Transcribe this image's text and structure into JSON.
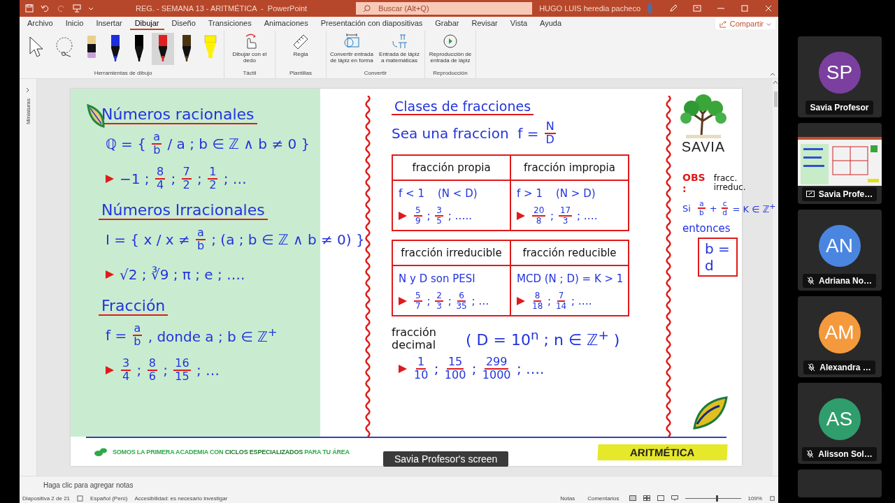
{
  "window": {
    "title": "REG. - SEMANA 13 - ARITMÉTICA  -  PowerPoint",
    "search": {
      "placeholder": "Buscar (Alt+Q)"
    },
    "user": "HUGO LUIS heredia pacheco"
  },
  "tabs": [
    {
      "label": "Archivo",
      "selected": false
    },
    {
      "label": "Inicio",
      "selected": false
    },
    {
      "label": "Insertar",
      "selected": false
    },
    {
      "label": "Dibujar",
      "selected": true
    },
    {
      "label": "Diseño",
      "selected": false
    },
    {
      "label": "Transiciones",
      "selected": false
    },
    {
      "label": "Animaciones",
      "selected": false
    },
    {
      "label": "Presentación con diapositivas",
      "selected": false
    },
    {
      "label": "Grabar",
      "selected": false
    },
    {
      "label": "Revisar",
      "selected": false
    },
    {
      "label": "Vista",
      "selected": false
    },
    {
      "label": "Ayuda",
      "selected": false
    }
  ],
  "share": "Compartir",
  "ribbon": {
    "drawing_tools": {
      "label": "Herramientas de dibujo",
      "pens": [
        {
          "kind": "eraser",
          "color": "#e8d08a",
          "selected": false
        },
        {
          "kind": "pen",
          "color": "#1c2fe0",
          "selected": false
        },
        {
          "kind": "pen",
          "color": "#000000",
          "selected": false
        },
        {
          "kind": "pen",
          "color": "#e02020",
          "selected": true
        },
        {
          "kind": "pen",
          "color": "#4a3410",
          "selected": false
        },
        {
          "kind": "highlighter",
          "color": "#fff200",
          "selected": false
        }
      ]
    },
    "groups": [
      {
        "label": "Táctil",
        "buttons": [
          {
            "kind": "finger",
            "label": "Dibujar con el dedo"
          }
        ]
      },
      {
        "label": "Plantillas",
        "buttons": [
          {
            "kind": "ruler",
            "label": "Regla"
          }
        ]
      },
      {
        "label": "Convertir",
        "buttons": [
          {
            "kind": "shape",
            "label": "Convertir entrada de lápiz en forma"
          },
          {
            "kind": "math",
            "label": "Entrada de lápiz a matemáticas"
          }
        ]
      },
      {
        "label": "Reproducción",
        "buttons": [
          {
            "kind": "replay",
            "label": "Reproducción de entrada de lápiz"
          }
        ]
      }
    ]
  },
  "thumbnails_pane": "Miniaturas",
  "slide": {
    "left": [
      {
        "kind": "heading",
        "text": "Números racionales"
      },
      {
        "kind": "formula",
        "items": [
          {
            "t": "ℚ = { "
          },
          {
            "n": "a",
            "d": "b"
          },
          {
            "t": " / a ; b ∈ ℤ ∧ b ≠ 0 }"
          }
        ]
      },
      {
        "kind": "bullet",
        "items": [
          {
            "t": "−1 ; "
          },
          {
            "n": "8",
            "d": "4"
          },
          {
            "t": " ; "
          },
          {
            "n": "7",
            "d": "2"
          },
          {
            "t": " ; "
          },
          {
            "n": "1",
            "d": "2"
          },
          {
            "t": " ; …"
          }
        ]
      },
      {
        "kind": "heading",
        "text": "Números Irracionales"
      },
      {
        "kind": "formula",
        "items": [
          {
            "t": "I = { x / x ≠ "
          },
          {
            "n": "a",
            "d": "b"
          },
          {
            "t": " ; (a ; b ∈ ℤ ∧ b ≠ 0) }"
          }
        ]
      },
      {
        "kind": "bullet",
        "items": [
          {
            "t": "√2 ; ∛9 ; π ; e ; …."
          }
        ]
      },
      {
        "kind": "heading",
        "text": "Fracción"
      },
      {
        "kind": "formula",
        "items": [
          {
            "t": "f = "
          },
          {
            "n": "a",
            "d": "b"
          },
          {
            "t": " , donde a ; b ∈ ℤ$^{+}$"
          }
        ]
      },
      {
        "kind": "bullet",
        "items": [
          {
            "n": "3",
            "d": "4"
          },
          {
            "t": " ; "
          },
          {
            "n": "8",
            "d": "6"
          },
          {
            "t": " ; "
          },
          {
            "n": "16",
            "d": "15"
          },
          {
            "t": " ; …"
          }
        ]
      }
    ],
    "middle": {
      "heading": "Clases de fracciones",
      "intro": [
        {
          "t": "Sea una fraccion  f = "
        },
        {
          "n": "N",
          "d": "D"
        }
      ],
      "tables": [
        {
          "columns": [
            {
              "header": "fracción propia",
              "lines": [
                {
                  "kind": "formula",
                  "items": [
                    {
                      "t": "f < 1    (N < D)"
                    }
                  ]
                },
                {
                  "kind": "bullet",
                  "items": [
                    {
                      "n": "5",
                      "d": "9"
                    },
                    {
                      "t": " ; "
                    },
                    {
                      "n": "3",
                      "d": "5"
                    },
                    {
                      "t": " ; ….."
                    }
                  ]
                }
              ]
            },
            {
              "header": "fracción impropia",
              "lines": [
                {
                  "kind": "formula",
                  "items": [
                    {
                      "t": "f > 1    (N > D)"
                    }
                  ]
                },
                {
                  "kind": "bullet",
                  "items": [
                    {
                      "n": "20",
                      "d": "8"
                    },
                    {
                      "t": " ; "
                    },
                    {
                      "n": "17",
                      "d": "3"
                    },
                    {
                      "t": " ; …."
                    }
                  ]
                }
              ]
            }
          ]
        },
        {
          "columns": [
            {
              "header": "fracción irreducible",
              "lines": [
                {
                  "kind": "formula",
                  "items": [
                    {
                      "t": "N y D son PESI"
                    }
                  ]
                },
                {
                  "kind": "bullet",
                  "items": [
                    {
                      "n": "5",
                      "d": "7"
                    },
                    {
                      "t": " ; "
                    },
                    {
                      "n": "2",
                      "d": "3"
                    },
                    {
                      "t": " ; "
                    },
                    {
                      "n": "6",
                      "d": "35"
                    },
                    {
                      "t": " ; …"
                    }
                  ]
                }
              ]
            },
            {
              "header": "fracción reducible",
              "lines": [
                {
                  "kind": "formula",
                  "items": [
                    {
                      "t": "MCD (N ; D) = K > 1"
                    }
                  ]
                },
                {
                  "kind": "bullet",
                  "items": [
                    {
                      "n": "8",
                      "d": "18"
                    },
                    {
                      "t": " ; "
                    },
                    {
                      "n": "7",
                      "d": "14"
                    },
                    {
                      "t": " ; …."
                    }
                  ]
                }
              ]
            }
          ]
        }
      ],
      "decimal": {
        "label": "fracción decimal",
        "formula": "( D = 10$^{n}$ ; n ∈ ℤ$^{+}$ )",
        "example": [
          {
            "n": "1",
            "d": "10"
          },
          {
            "t": " ; "
          },
          {
            "n": "15",
            "d": "100"
          },
          {
            "t": " ; "
          },
          {
            "n": "299",
            "d": "1000"
          },
          {
            "t": " ; …."
          }
        ]
      }
    },
    "right": {
      "logo": "SAVIA",
      "obs": "OBS :",
      "note": "fracc. irreduc.",
      "condition": [
        {
          "t": "Si  "
        },
        {
          "n": "a",
          "d": "b"
        },
        {
          "t": " + "
        },
        {
          "n": "c",
          "d": "d"
        },
        {
          "t": " = K ∈ ℤ$^{+}$"
        }
      ],
      "then": "entonces",
      "result": "b = d"
    },
    "footer": {
      "slogan": "SOMOS LA PRIMERA ACADEMIA CON **CICLOS ESPECIALIZADOS** PARA TU ÁREA",
      "course": "ARITMÉTICA"
    }
  },
  "notes_placeholder": "Haga clic para agregar notas",
  "status_bar": {
    "slide": "Diapositiva 2 de 21",
    "language": "Español (Perú)",
    "accessibility": "Accesibilidad: es necesario investigar",
    "notes": "Notas",
    "comments": "Comentarios",
    "zoom": "109%",
    "zoom_slider": {
      "level": 0.55
    }
  },
  "share_banner": "Savia Profesor's screen",
  "participants": [
    {
      "kind": "avatar",
      "initials": "SP",
      "name": "Savia Profesor",
      "color": "#7b3fa0",
      "muted": false
    },
    {
      "kind": "screen",
      "name": "Savia Profe…",
      "muted": false
    },
    {
      "kind": "avatar",
      "initials": "AN",
      "name": "Adriana No…",
      "color": "#4a86e0",
      "muted": true
    },
    {
      "kind": "avatar",
      "initials": "AM",
      "name": "Alexandra …",
      "color": "#f59a3c",
      "muted": true
    },
    {
      "kind": "avatar",
      "initials": "AS",
      "name": "Alisson Sol…",
      "color": "#2f9e6c",
      "muted": true
    }
  ]
}
